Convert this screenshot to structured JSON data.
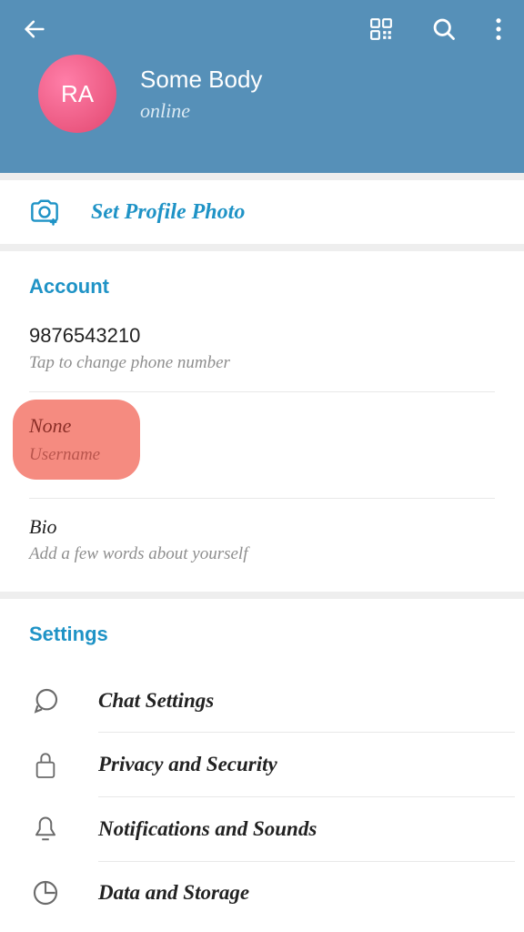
{
  "header": {
    "avatar_initials": "RA",
    "name": "Some Body",
    "status": "online"
  },
  "photo": {
    "set_label": "Set Profile Photo"
  },
  "account": {
    "title": "Account",
    "phone": {
      "value": "9876543210",
      "hint": "Tap to change phone number"
    },
    "username": {
      "value": "None",
      "hint": "Username"
    },
    "bio": {
      "value": "Bio",
      "hint": "Add a few words about yourself"
    }
  },
  "settings": {
    "title": "Settings",
    "items": [
      {
        "label": "Chat Settings"
      },
      {
        "label": "Privacy and Security"
      },
      {
        "label": "Notifications and Sounds"
      },
      {
        "label": "Data and Storage"
      }
    ]
  }
}
